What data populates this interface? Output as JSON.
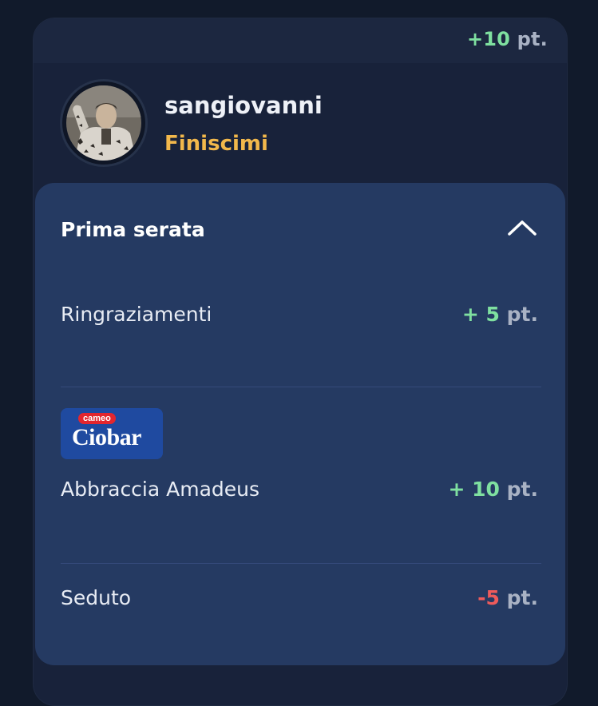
{
  "card": {
    "total_score": {
      "sign_value": "+10",
      "unit": "pt."
    },
    "artist": {
      "name": "sangiovanni",
      "song": "Finiscimi",
      "avatar_icon": "artist-photo"
    }
  },
  "section": {
    "title": "Prima serata",
    "expanded": true,
    "toggle_icon": "chevron-up-icon",
    "items": [
      {
        "label": "Ringraziamenti",
        "value": "+ 5",
        "unit": "pt.",
        "positive": true,
        "sponsor": null
      },
      {
        "label": "Abbraccia Amadeus",
        "value": "+ 10",
        "unit": "pt.",
        "positive": true,
        "sponsor": {
          "top_text": "cameo",
          "brand": "Ciobar"
        }
      },
      {
        "label": "Seduto",
        "value": "-5",
        "unit": "pt.",
        "positive": false,
        "sponsor": null
      }
    ]
  },
  "colors": {
    "background": "#111a2b",
    "card": "#18223a",
    "panel": "#253a62",
    "positive": "#7fe0a0",
    "negative": "#ef5b5b",
    "accent_song": "#f2b84b",
    "muted": "#a9b2c4"
  }
}
